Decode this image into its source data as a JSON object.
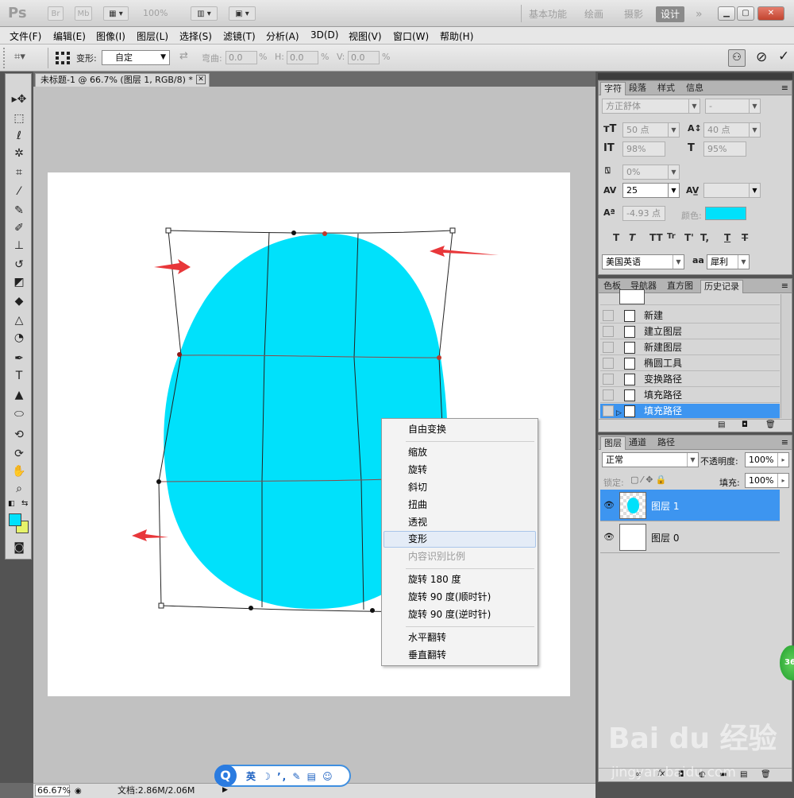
{
  "titlebar": {
    "logo": "Ps",
    "br": "Br",
    "mb": "Mb",
    "zoom": "100%",
    "workspaces": [
      "基本功能",
      "绘画",
      "摄影",
      "设计"
    ],
    "workspace_more": "»",
    "active_workspace": "设计"
  },
  "menu": [
    "文件(F)",
    "编辑(E)",
    "图像(I)",
    "图层(L)",
    "选择(S)",
    "滤镜(T)",
    "分析(A)",
    "3D(D)",
    "视图(V)",
    "窗口(W)",
    "帮助(H)"
  ],
  "options": {
    "transform_label": "变形:",
    "transform_value": "自定",
    "bend_label": "弯曲:",
    "bend_value": "0.0",
    "h_label": "H:",
    "h_value": "0.0",
    "v_label": "V:",
    "v_value": "0.0",
    "percent": "%"
  },
  "document": {
    "tab_title": "未标题-1 @ 66.7% (图层 1, RGB/8) *",
    "zoom": "66.67%",
    "doc_info": "文档:2.86M/2.06M",
    "shape_color": "#00e1fb"
  },
  "ime": {
    "logo": "Q",
    "text": "英 ☽ ’, ✎ ▤ ☺"
  },
  "context_menu": {
    "items": [
      {
        "label": "自由变换"
      },
      {
        "label": "缩放"
      },
      {
        "label": "旋转"
      },
      {
        "label": "斜切"
      },
      {
        "label": "扭曲"
      },
      {
        "label": "透视"
      },
      {
        "label": "变形"
      },
      {
        "label": "内容识别比例"
      },
      {
        "label": "旋转 180 度"
      },
      {
        "label": "旋转 90 度(顺时针)"
      },
      {
        "label": "旋转 90 度(逆时针)"
      },
      {
        "label": "水平翻转"
      },
      {
        "label": "垂直翻转"
      }
    ],
    "highlighted": "变形"
  },
  "character_panel": {
    "tabs": [
      "字符",
      "段落",
      "样式",
      "信息"
    ],
    "font_family": "方正舒体",
    "font_style": "-",
    "size": "50 点",
    "leading": "40 点",
    "vertical_scale": "98%",
    "horizontal_scale": "95%",
    "tracking_pct": "0%",
    "kerning": "25",
    "baseline_shift": "-4.93 点",
    "color_label": "颜色:",
    "color_value": "#00e1fb",
    "style_buttons": [
      "T",
      "T",
      "TT",
      "Tr",
      "T'",
      "T,",
      "T",
      "T"
    ],
    "language": "美国英语",
    "aa_label": "aa",
    "anti_alias": "犀利"
  },
  "history_panel": {
    "tabs": [
      "色板",
      "导航器",
      "直方图",
      "历史记录"
    ],
    "items": [
      "新建",
      "建立图层",
      "新建图层",
      "椭圆工具",
      "变换路径",
      "填充路径",
      "填充路径"
    ],
    "active_index": 6
  },
  "layers_panel": {
    "tabs": [
      "图层",
      "通道",
      "路径"
    ],
    "blend_mode": "正常",
    "opacity_label": "不透明度:",
    "opacity": "100%",
    "lock_label": "锁定:",
    "fill_label": "填充:",
    "fill": "100%",
    "layers": [
      "图层 1",
      "图层 0"
    ],
    "active_layer": "图层 1"
  },
  "watermark": {
    "brand": "Bai du 经验",
    "url": "jingyan.baidu.com",
    "badge": "36"
  }
}
